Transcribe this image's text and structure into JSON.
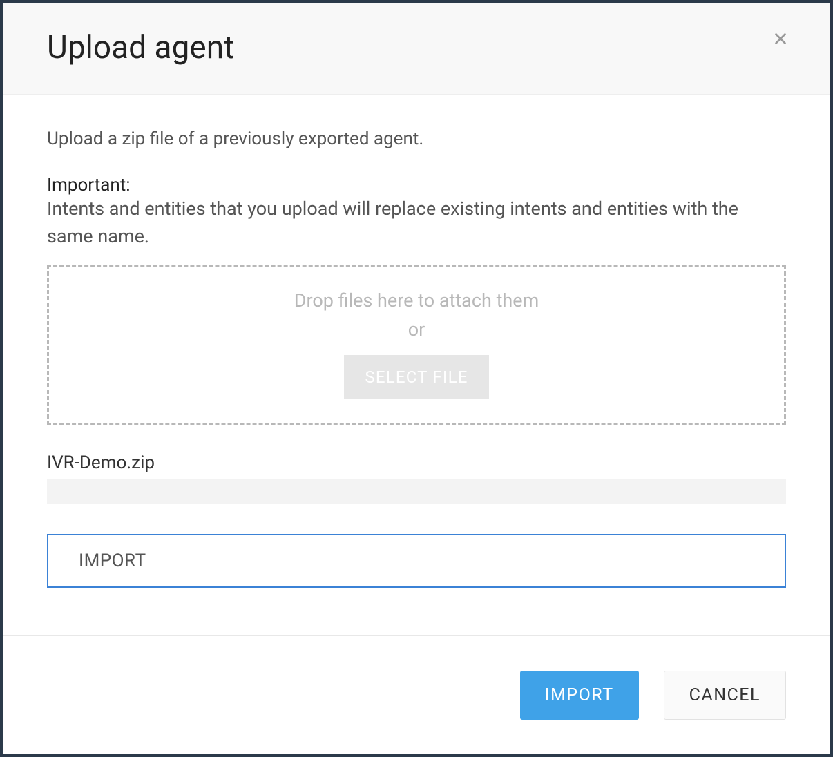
{
  "modal": {
    "title": "Upload agent",
    "intro": "Upload a zip file of a previously exported agent.",
    "important_label": "Important:",
    "important_text": "Intents and entities that you upload will replace existing intents and entities with the same name.",
    "dropzone": {
      "line1": "Drop files here to attach them",
      "line2": "or",
      "select_button": "SELECT FILE"
    },
    "selected_file": "IVR-Demo.zip",
    "confirm_value": "IMPORT",
    "footer": {
      "import_label": "IMPORT",
      "cancel_label": "CANCEL"
    }
  }
}
